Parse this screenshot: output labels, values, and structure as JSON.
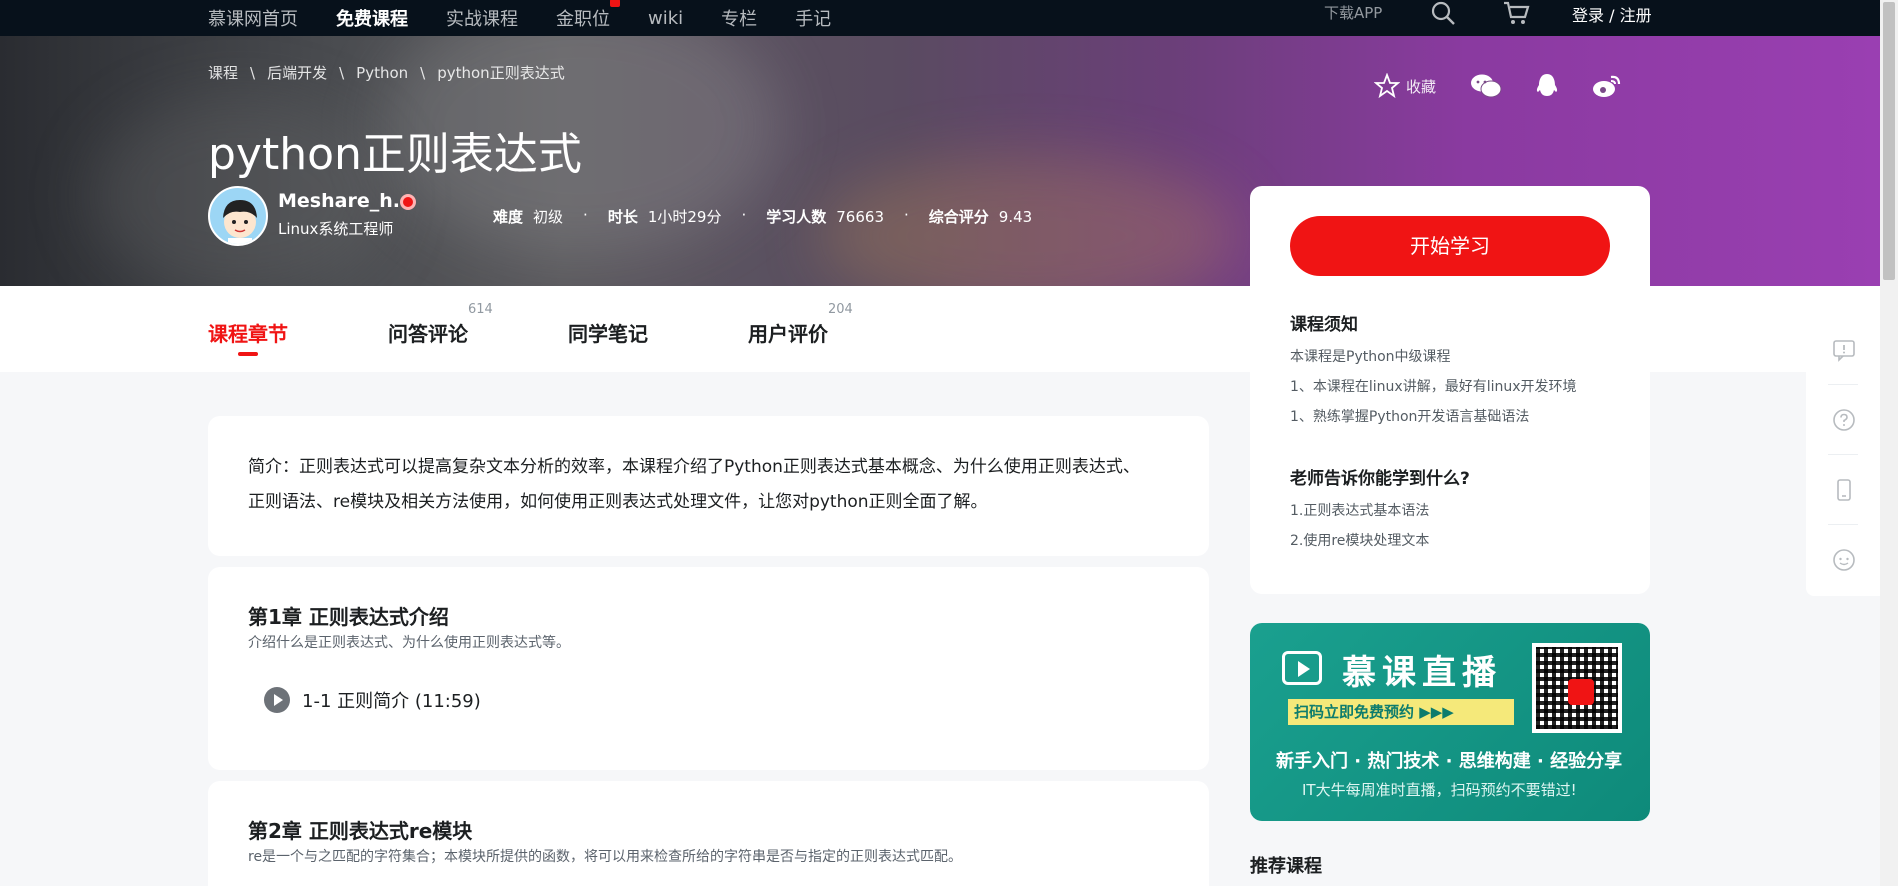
{
  "topnav": {
    "links": [
      "慕课网首页",
      "免费课程",
      "实战课程",
      "金职位",
      "wiki",
      "专栏",
      "手记"
    ],
    "download_app": "下载APP",
    "login": "登录 / 注册"
  },
  "breadcrumb": [
    "课程",
    "后端开发",
    "Python",
    "python正则表达式"
  ],
  "course": {
    "title": "python正则表达式",
    "author_name": "Meshare_h...",
    "author_title": "Linux系统工程师",
    "difficulty_label": "难度",
    "difficulty": "初级",
    "duration_label": "时长",
    "duration": "1小时29分",
    "learners_label": "学习人数",
    "learners": "76663",
    "rating_label": "综合评分",
    "rating": "9.43"
  },
  "share": {
    "favorite": "收藏"
  },
  "tabs": [
    {
      "label": "课程章节",
      "count": ""
    },
    {
      "label": "问答评论",
      "count": "614"
    },
    {
      "label": "同学笔记",
      "count": ""
    },
    {
      "label": "用户评价",
      "count": "204"
    }
  ],
  "intro": {
    "line1": "简介：正则表达式可以提高复杂文本分析的效率，本课程介绍了Python正则表达式基本概念、为什么使用正则表达式、",
    "line2": "正则语法、re模块及相关方法使用，如何使用正则表达式处理文件，让您对python正则全面了解。"
  },
  "chapters": [
    {
      "title": "第1章 正则表达式介绍",
      "desc": "介绍什么是正则表达式、为什么使用正则表达式等。",
      "lessons": [
        "1-1 正则简介 (11:59)"
      ]
    },
    {
      "title": "第2章 正则表达式re模块",
      "desc": "re是一个与之匹配的字符集合；本模块所提供的函数，将可以用来检查所给的字符串是否与指定的正则表达式匹配。"
    }
  ],
  "sidebar": {
    "start_button": "开始学习",
    "notice_title": "课程须知",
    "notices": [
      "本课程是Python中级课程",
      "1、本课程在linux讲解，最好有linux开发环境",
      "1、熟练掌握Python开发语言基础语法"
    ],
    "learn_title": "老师告诉你能学到什么?",
    "learn_items": [
      "1.正则表达式基本语法",
      "2.使用re模块处理文本"
    ],
    "recommend_title": "推荐课程"
  },
  "banner": {
    "title": "慕课直播",
    "strip": "扫码立即免费预约 ▶▶▶",
    "line1": "新手入门 · 热门技术 · 思维构建 · 经验分享",
    "line2": "IT大牛每周准时直播，扫码预约不要错过!"
  },
  "colors": {
    "accent": "#f01414",
    "nav_bg": "#07111b",
    "banner_bg": "#1aa08f"
  }
}
